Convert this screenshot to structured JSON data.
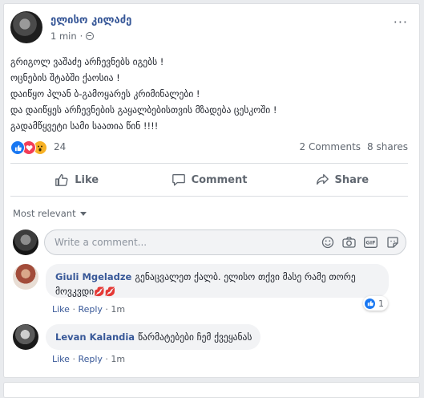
{
  "post": {
    "author": "ელისო კილაძე",
    "time": "1 min",
    "more": "···",
    "lines": [
      "გრიგოლ ვაშაძე არჩევნებს იგებს !",
      "ოცნების შტაბში ქაოსია !",
      "დაიწყო პლან ბ-გამოყარეს კრიმინალები !",
      "და დაიწყეს არჩევნების გაყალბებისთვის მზადება ცესკოში !",
      "გადამწყვეტი სამი საათია წინ !!!!"
    ],
    "reaction_count": "24",
    "comments_count": "2 Comments",
    "shares_count": "8 shares",
    "reaction_types": [
      "like",
      "love",
      "wow"
    ]
  },
  "actions": {
    "like": "Like",
    "comment": "Comment",
    "share": "Share"
  },
  "sort_label": "Most relevant",
  "composer": {
    "placeholder": "Write a comment...",
    "icons": [
      "emoji-icon",
      "camera-icon",
      "gif-icon",
      "sticker-icon"
    ]
  },
  "comments": [
    {
      "name": "Giuli Mgeladze",
      "text_line1": "გენაცვალეთ ქალბ. ელისო თქვი მასე რამე თორე",
      "text_line2": "მოვკვდი",
      "emoji": "💋💋",
      "like": "Like",
      "reply": "Reply",
      "sep": "·",
      "time": "1m",
      "likes": "1"
    },
    {
      "name": "Levan Kalandia",
      "text_line1": "წარმატებები ჩემ ქვეყანას",
      "like": "Like",
      "reply": "Reply",
      "sep": "·",
      "time": "1m"
    }
  ],
  "colors": {
    "link": "#385898",
    "like_blue": "#1877f2",
    "love_red": "#f33e58",
    "wow_yellow": "#f7b125"
  }
}
